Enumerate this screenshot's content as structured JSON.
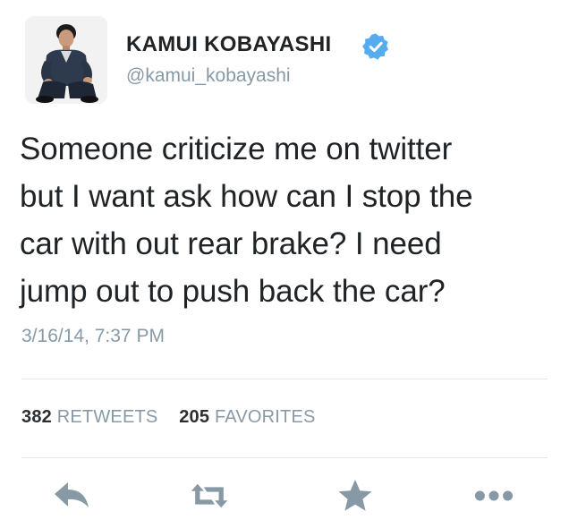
{
  "user": {
    "display_name": "KAMUI KOBAYASHI",
    "handle": "@kamui_kobayashi",
    "verified": true
  },
  "tweet": {
    "lines": [
      "Someone criticize me on twitter",
      "but I want ask how can I stop the",
      "car with out rear brake? I need",
      "jump out to push back the car?"
    ],
    "timestamp": "3/16/14, 7:37 PM"
  },
  "stats": {
    "retweets_count": "382",
    "retweets_label": "RETWEETS",
    "favorites_count": "205",
    "favorites_label": "FAVORITES"
  },
  "actions": [
    {
      "icon": "reply-icon"
    },
    {
      "icon": "retweet-icon"
    },
    {
      "icon": "favorite-star-icon"
    },
    {
      "icon": "more-dots-icon"
    }
  ],
  "colors": {
    "verified_blue": "#55acee",
    "icon_gray": "#8899a6",
    "meta_gray": "#8899a6",
    "divider": "#e1e8ed",
    "text": "#1f2326"
  }
}
